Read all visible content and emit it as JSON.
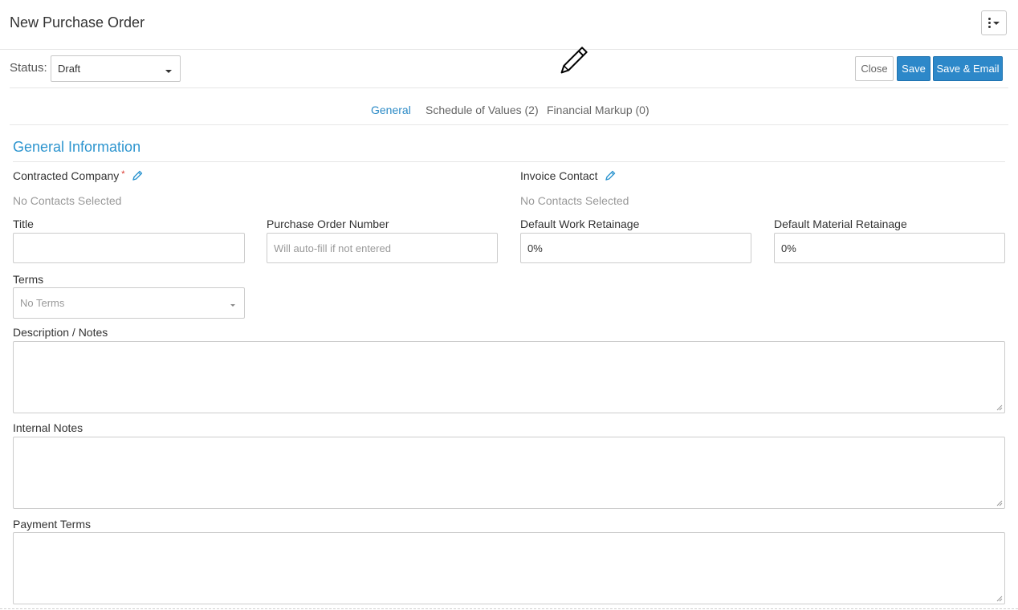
{
  "header": {
    "title": "New Purchase Order",
    "more_menu_icon": "kebab-dropdown-icon"
  },
  "toolbar": {
    "status_label": "Status:",
    "status_value": "Draft",
    "close_label": "Close",
    "save_label": "Save",
    "save_email_label": "Save & Email"
  },
  "tabs": [
    {
      "label": "General",
      "active": true
    },
    {
      "label": "Schedule of Values (2)",
      "active": false
    },
    {
      "label": "Financial Markup (0)",
      "active": false
    }
  ],
  "section": {
    "title": "General Information"
  },
  "fields": {
    "contracted_company": {
      "label": "Contracted Company",
      "required_mark": "*",
      "value": "No Contacts Selected"
    },
    "invoice_contact": {
      "label": "Invoice Contact",
      "value": "No Contacts Selected"
    },
    "title": {
      "label": "Title",
      "value": ""
    },
    "po_number": {
      "label": "Purchase Order Number",
      "placeholder": "Will auto-fill if not entered"
    },
    "work_retainage": {
      "label": "Default Work Retainage",
      "value": "0%"
    },
    "material_retainage": {
      "label": "Default Material Retainage",
      "value": "0%"
    },
    "terms": {
      "label": "Terms",
      "value": "No Terms"
    },
    "description": {
      "label": "Description / Notes",
      "value": ""
    },
    "internal_notes": {
      "label": "Internal Notes",
      "value": ""
    },
    "payment_terms": {
      "label": "Payment Terms",
      "value": ""
    }
  },
  "colors": {
    "accent": "#2d95cf",
    "primary_button": "#2d88c9",
    "required": "#d9342b"
  }
}
